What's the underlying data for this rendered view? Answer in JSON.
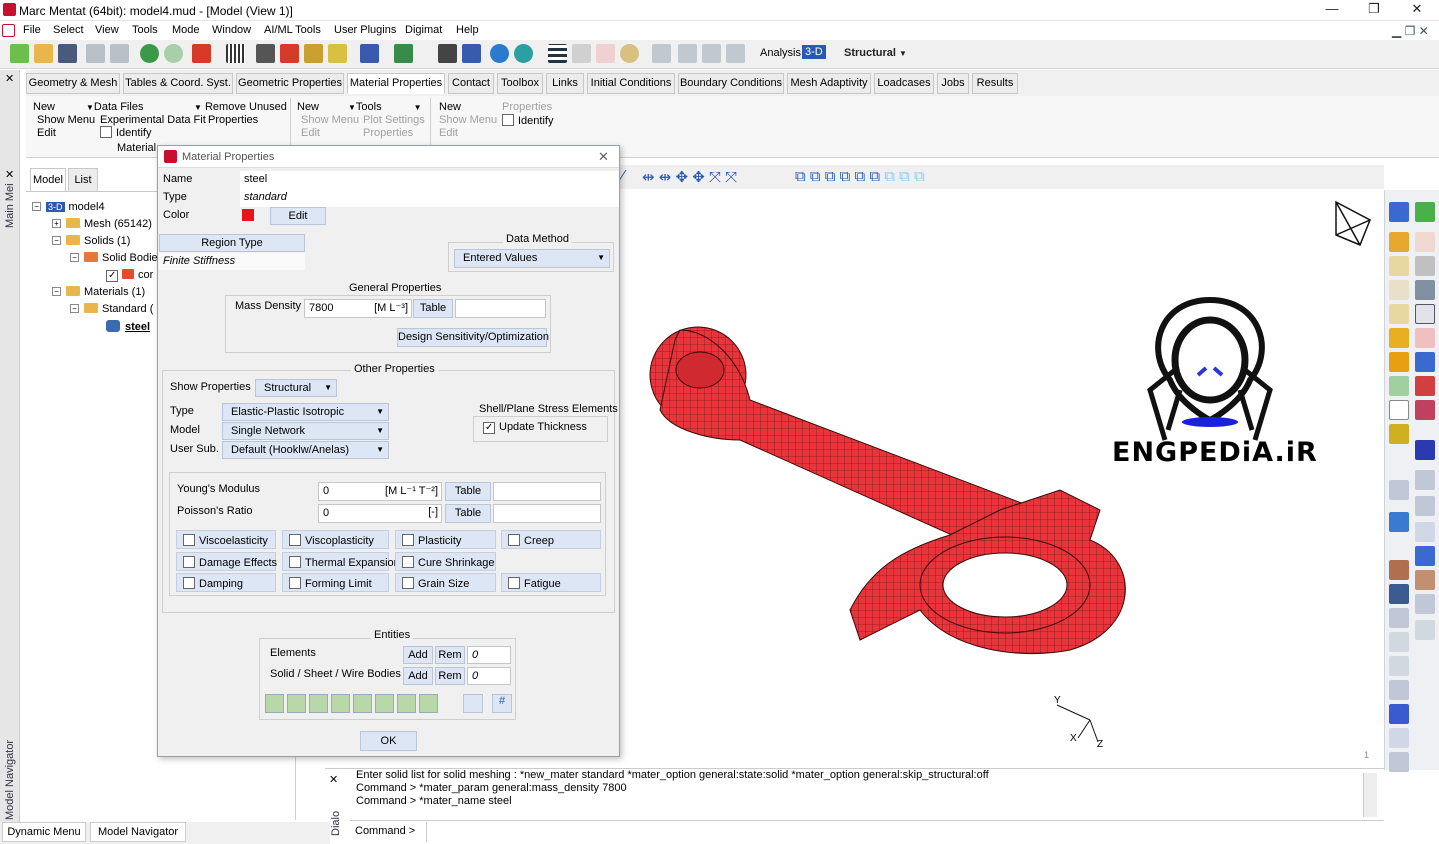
{
  "window": {
    "title": "Marc Mentat (64bit): model4.mud - [Model (View 1)]"
  },
  "menu": [
    "File",
    "Select",
    "View",
    "Tools",
    "Mode",
    "Window",
    "AI/ML Tools",
    "User Plugins",
    "Digimat",
    "Help"
  ],
  "toolbar": {
    "analysis_label": "Analysis",
    "analysis_dim": "3-D",
    "analysis_type": "Structural"
  },
  "tabs": [
    "Geometry & Mesh",
    "Tables & Coord. Syst.",
    "Geometric Properties",
    "Material Properties",
    "Contact",
    "Toolbox",
    "Links",
    "Initial Conditions",
    "Boundary Conditions",
    "Mesh Adaptivity",
    "Loadcases",
    "Jobs",
    "Results"
  ],
  "ribbon": {
    "g1": {
      "new": "New",
      "show_menu": "Show Menu",
      "edit": "Edit",
      "data_files": "Data Files",
      "exp_fit": "Experimental Data Fit",
      "identify": "Identify",
      "remove_unused": "Remove Unused",
      "properties": "Properties",
      "caption": "Material"
    },
    "g2": {
      "new": "New",
      "show_menu": "Show Menu",
      "edit": "Edit",
      "tools": "Tools",
      "plot_settings": "Plot Settings",
      "properties": "Properties"
    },
    "g3": {
      "new": "New",
      "show_menu": "Show Menu",
      "edit": "Edit",
      "properties": "Properties",
      "identify": "Identify"
    }
  },
  "left_strip": {
    "main_menu": "Main Mei",
    "model_navigator": "Model Navigator"
  },
  "nav": {
    "tab_model": "Model",
    "tab_list": "List",
    "root": "model4",
    "dim": "3-D",
    "mesh": "Mesh (65142)",
    "solids": "Solids (1)",
    "solid_bodies": "Solid Bodie",
    "solid_child": "cor",
    "materials": "Materials (1)",
    "standard": "Standard (",
    "steel": "steel"
  },
  "dialog": {
    "title": "Material Properties",
    "name_label": "Name",
    "name_value": "steel",
    "type_label": "Type",
    "type_value": "standard",
    "color_label": "Color",
    "color_hex": "#e8141a",
    "edit": "Edit",
    "region_type": "Region Type",
    "finite_stiffness": "Finite Stiffness",
    "data_method_label": "Data Method",
    "data_method_value": "Entered Values",
    "general_props": "General Properties",
    "mass_density_label": "Mass Density",
    "mass_density_value": "7800",
    "mass_density_unit": "[M L⁻³]",
    "table": "Table",
    "design_sens": "Design Sensitivity/Optimization",
    "other_props": "Other Properties",
    "show_props_label": "Show Properties",
    "show_props_value": "Structural",
    "type2_label": "Type",
    "type2_value": "Elastic-Plastic Isotropic",
    "model_label": "Model",
    "model_value": "Single Network",
    "usersub_label": "User Sub.",
    "usersub_value": "Default (Hooklw/Anelas)",
    "shell_title": "Shell/Plane Stress Elements",
    "update_thickness": "Update Thickness",
    "youngs_label": "Young's Modulus",
    "youngs_value": "0",
    "youngs_unit": "[M L⁻¹ T⁻²]",
    "poisson_label": "Poisson's Ratio",
    "poisson_value": "0",
    "poisson_unit": "[-]",
    "checks": [
      "Viscoelasticity",
      "Viscoplasticity",
      "Plasticity",
      "Creep",
      "Damage Effects",
      "Thermal Expansion",
      "Cure Shrinkage",
      "Grain Size",
      "Damping",
      "Forming Limit",
      "Fatigue"
    ],
    "entities": "Entities",
    "elements": "Elements",
    "solid_sheet": "Solid / Sheet / Wire Bodies",
    "add": "Add",
    "rem": "Rem",
    "elements_count": "0",
    "bodies_count": "0",
    "ok": "OK"
  },
  "viewport": {
    "watermark": "ENGPEDiA.iR",
    "axis_y": "Y",
    "axis_x": "X",
    "axis_z": "Z",
    "view_num": "1",
    "mesh_color": "#e8343a"
  },
  "console": {
    "line1": "Enter solid list for solid meshing : *new_mater standard *mater_option general:state:solid *mater_option general:skip_structural:off",
    "line2": "Command > *mater_param general:mass_density 7800",
    "line3": "Command > *mater_name steel",
    "prompt": "Command >",
    "side_label": "Dialo"
  },
  "bottom_tabs": [
    "Dynamic Menu",
    "Model Navigator"
  ]
}
